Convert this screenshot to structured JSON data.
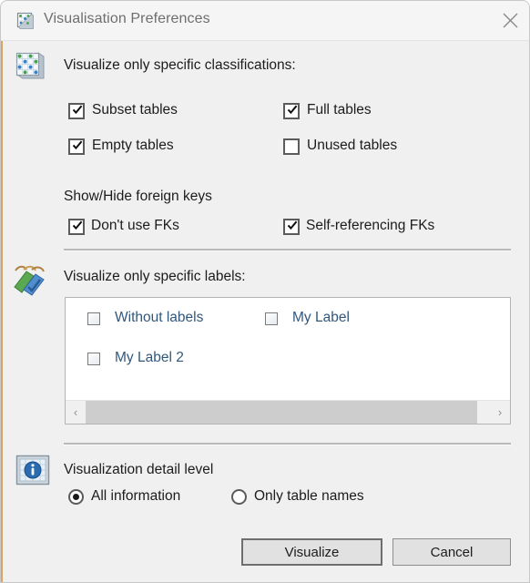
{
  "window": {
    "title": "Visualisation Preferences",
    "icon": "visualisation-icon",
    "close_icon": "close-icon"
  },
  "classifications": {
    "icon": "tables-grid-icon",
    "heading": "Visualize only specific classifications:",
    "options": [
      {
        "label": "Subset tables",
        "checked": true
      },
      {
        "label": "Full tables",
        "checked": true
      },
      {
        "label": "Empty tables",
        "checked": true
      },
      {
        "label": "Unused tables",
        "checked": false
      }
    ]
  },
  "foreign_keys": {
    "heading": "Show/Hide foreign keys",
    "options": [
      {
        "label": "Don't use FKs",
        "checked": true
      },
      {
        "label": "Self-referencing FKs",
        "checked": true
      }
    ]
  },
  "labels": {
    "icon": "labels-ribbon-icon",
    "heading": "Visualize only specific labels:",
    "items": [
      {
        "label": "Without labels",
        "checked": false
      },
      {
        "label": "My Label",
        "checked": false
      },
      {
        "label": "My Label 2",
        "checked": false
      }
    ],
    "scrollbar": {
      "left_arrow": "‹",
      "right_arrow": "›"
    }
  },
  "detail_level": {
    "icon": "info-icon",
    "heading": "Visualization detail level",
    "options": [
      {
        "label": "All information",
        "selected": true
      },
      {
        "label": "Only table names",
        "selected": false
      }
    ]
  },
  "footer": {
    "visualize_label": "Visualize",
    "cancel_label": "Cancel"
  },
  "colors": {
    "dialog_bg": "#f0f0f0",
    "titlebar_bg": "#f5f5f5",
    "title_text": "#6e6e6e",
    "body_text": "#1c1c1c",
    "label_link": "#31577d",
    "separator": "#b9b9b9",
    "accent_strip": "#d9a463"
  }
}
